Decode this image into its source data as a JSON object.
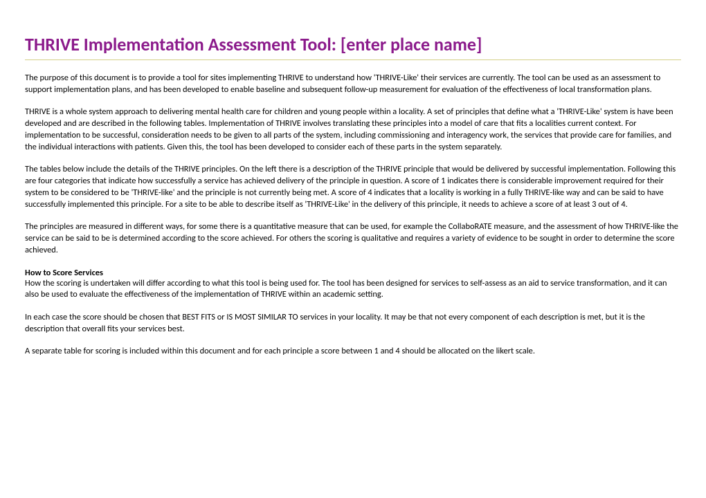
{
  "document": {
    "title": "THRIVE Implementation Assessment Tool: [enter place name]",
    "paragraphs": {
      "p1": "The purpose of this document is to provide a tool for sites implementing THRIVE to understand how 'THRIVE-Like' their services are currently. The tool can be used as an assessment to support implementation plans, and has been developed to enable baseline and subsequent follow-up measurement for evaluation of the effectiveness of local transformation plans.",
      "p2": "THRIVE is a whole system approach to delivering mental health care for children and young people within a locality. A set of principles that define what a 'THRIVE-Like' system is have been developed and are described in the following tables. Implementation of THRIVE involves translating these principles into a model of care that fits a localities current context. For implementation to be successful, consideration needs to be given to all parts of the system, including commissioning and interagency work, the services that provide care for families, and the individual interactions with patients.  Given this, the tool has been developed to consider each of these parts in the system separately.",
      "p3": "The tables below include the details of the THRIVE principles. On the left there is a description of the THRIVE principle that would be delivered by successful implementation. Following this are four categories that indicate how successfully a service has achieved delivery of the principle in question. A score of 1 indicates there is considerable improvement required for their system to be considered to be 'THRIVE-like' and the principle is not currently being met. A score of 4 indicates that a locality is working in a fully THRIVE-like way and can be said to have successfully implemented this principle. For a site to be able to describe itself as 'THRIVE-Like' in the delivery of this principle, it needs to achieve a score of at least 3 out of 4.",
      "p4": "The principles are measured in different ways, for some there is a quantitative measure that can be used, for example the CollaboRATE measure, and the assessment of how THRIVE-like the service can be said to be is determined according to the score achieved. For others the scoring is qualitative and requires a variety of evidence to be sought in order to determine the score achieved.",
      "subheading": "How to Score Services",
      "p5": "How the scoring is undertaken will differ according to what this tool is being used for. The tool has been designed for services to self-assess as an aid to service transformation, and it can also be used to evaluate the effectiveness of the implementation of THRIVE within an academic setting.",
      "p6": "In each case the score should be chosen that BEST FITS or IS MOST SIMILAR TO services in your locality. It may be that not every component of each description is met, but it is the description that overall fits your services best.",
      "p7": "A separate table for scoring is included within this document and for each principle a score between 1 and 4 should be allocated on the likert scale."
    }
  }
}
